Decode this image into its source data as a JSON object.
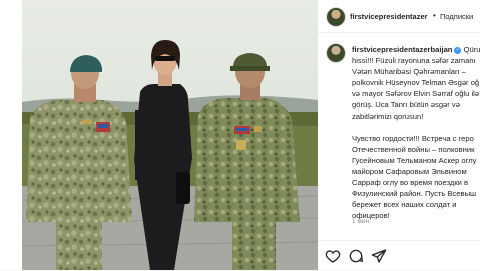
{
  "header": {
    "username": "firstvicepresidentazer",
    "separator": "•",
    "follow_label": "Подписки"
  },
  "post": {
    "author": "firstvicepresidentazerbaijan",
    "caption_lines": [
      "Qürur",
      "hissi!!! Füzuli rayonuna səfər zamanı",
      "Vətən Müharibəsi Qəhrəmanları –",
      "polkovnik Hüseynov Telman Əsgər oğ",
      "və mayor Səfərov Elvin Sərraf oğlu ilə",
      "görüş. Uca Tanrı bütün əsgər və",
      "zabitlərimizi qorusun!"
    ],
    "caption_ru_lines": [
      "Чувство гордости!!! Встреча с геро",
      "Отечественной войны – полковник",
      "Гусейновым Тельманом Аскер оглу",
      "майором Сафаровым Эльвином",
      "Сарраф оглу во время поездки в",
      "Физулинский район. Пусть Всевыш",
      "бережет всех наших солдат и",
      "офицеров!"
    ],
    "time_ago": "1 мин."
  },
  "icons": {
    "verified": "verified-badge-icon",
    "like": "heart-icon",
    "comment": "comment-icon",
    "share": "share-icon"
  },
  "colors": {
    "verified": "#3897f0",
    "text": "#262626",
    "muted": "#8e8e8e"
  }
}
